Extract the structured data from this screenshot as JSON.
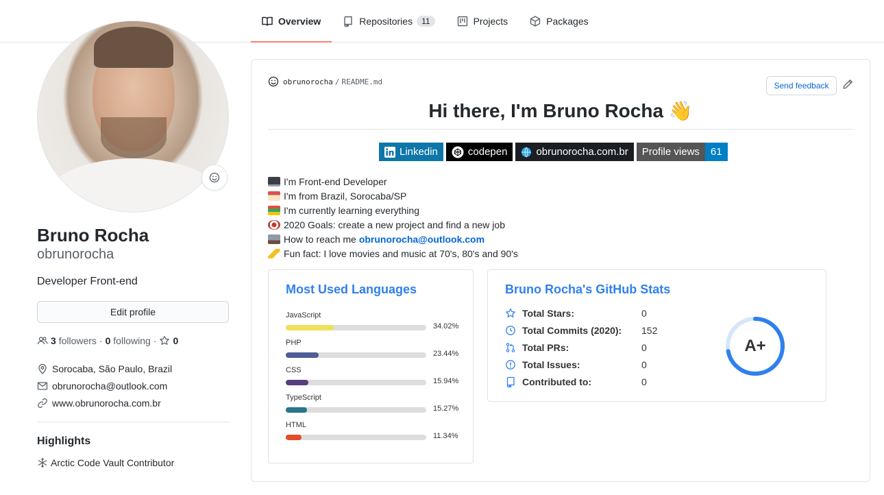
{
  "tabs": [
    {
      "label": "Overview",
      "icon": "book-icon",
      "active": true
    },
    {
      "label": "Repositories",
      "icon": "repo-icon",
      "count": "11"
    },
    {
      "label": "Projects",
      "icon": "project-icon"
    },
    {
      "label": "Packages",
      "icon": "package-icon"
    }
  ],
  "profile": {
    "fullname": "Bruno Rocha",
    "username": "obrunorocha",
    "bio": "Developer Front-end",
    "edit_label": "Edit profile",
    "followers_count": "3",
    "followers_label": "followers",
    "following_count": "0",
    "following_label": "following",
    "stars_count": "0",
    "location": "Sorocaba, São Paulo, Brazil",
    "email": "obrunorocha@outlook.com",
    "website": "www.obrunorocha.com.br",
    "highlights_title": "Highlights",
    "highlight": "Arctic Code Vault Contributor"
  },
  "readme": {
    "owner": "obrunorocha",
    "separator": "/",
    "file": "README.md",
    "feedback_label": "Send feedback",
    "title": "Hi there, I'm Bruno Rocha 👋",
    "badges": {
      "linkedin": "Linkedin",
      "codepen": "codepen",
      "website": "obrunorocha.com.br",
      "views_label": "Profile views",
      "views_count": "61"
    },
    "lines": [
      "I'm Front-end Developer",
      "I'm from Brazil, Sorocaba/SP",
      "I'm currently learning everything",
      "2020 Goals: create a new project and find a new job",
      "How to reach me",
      "Fun fact: I love movies and music at 70's, 80's and 90's"
    ],
    "contact_email": "obrunorocha@outlook.com"
  },
  "languages": {
    "title": "Most Used Languages",
    "items": [
      {
        "name": "JavaScript",
        "percent": "34.02%",
        "value": 34.02,
        "color": "#f1e05a"
      },
      {
        "name": "PHP",
        "percent": "23.44%",
        "value": 23.44,
        "color": "#4F5D95"
      },
      {
        "name": "CSS",
        "percent": "15.94%",
        "value": 15.94,
        "color": "#563d7c"
      },
      {
        "name": "TypeScript",
        "percent": "15.27%",
        "value": 15.27,
        "color": "#2b7489"
      },
      {
        "name": "HTML",
        "percent": "11.34%",
        "value": 11.34,
        "color": "#e34c26"
      }
    ]
  },
  "stats": {
    "title": "Bruno Rocha's GitHub Stats",
    "items": [
      {
        "label": "Total Stars:",
        "value": "0",
        "icon": "star-icon"
      },
      {
        "label": "Total Commits (2020):",
        "value": "152",
        "icon": "history-icon"
      },
      {
        "label": "Total PRs:",
        "value": "0",
        "icon": "pull-request-icon"
      },
      {
        "label": "Total Issues:",
        "value": "0",
        "icon": "issue-icon"
      },
      {
        "label": "Contributed to:",
        "value": "0",
        "icon": "repo-icon"
      }
    ],
    "grade": "A+",
    "grade_progress": 0.72,
    "accent": "#2f80ed"
  }
}
